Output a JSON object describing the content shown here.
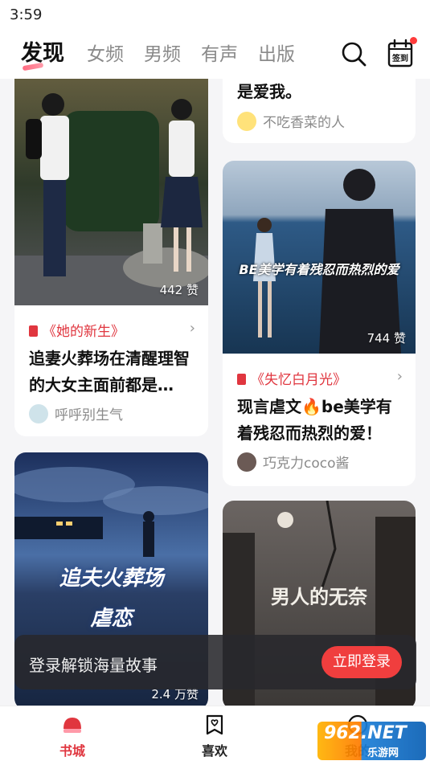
{
  "status": {
    "time": "3:59"
  },
  "tabs": [
    {
      "label": "发现",
      "active": true
    },
    {
      "label": "女频",
      "active": false
    },
    {
      "label": "男频",
      "active": false
    },
    {
      "label": "有声",
      "active": false
    },
    {
      "label": "出版",
      "active": false
    }
  ],
  "header": {
    "signin_label": "签到"
  },
  "cards": [
    {
      "likes": "442 赞",
      "book": "《她的新生》",
      "title": "追妻火葬场在清醒理智的大女主面前都是…",
      "author": "呼呼别生气"
    },
    {
      "title_tail": "是爱我。",
      "author": "不吃香菜的人"
    },
    {
      "likes": "744 赞",
      "overlay": "BE美学有着残忍而热烈的爱",
      "book": "《失忆白月光》",
      "title": "现言虐文🔥be美学有着残忍而热烈的爱！",
      "author": "巧克力coco酱"
    },
    {
      "likes": "2.4 万赞",
      "overlay1": "追夫火葬场",
      "overlay2": "虐恋"
    },
    {
      "overlay": "男人的无奈"
    }
  ],
  "login_banner": {
    "text": "登录解锁海量故事",
    "button": "立即登录"
  },
  "bottom_nav": [
    {
      "label": "书城",
      "active": true
    },
    {
      "label": "喜欢",
      "active": false
    },
    {
      "label": "我的",
      "active": false
    }
  ],
  "watermark": {
    "text": "962.NET",
    "sub": "乐游网"
  },
  "colors": {
    "accent": "#e0363f",
    "login_button": "#f03e3e"
  }
}
